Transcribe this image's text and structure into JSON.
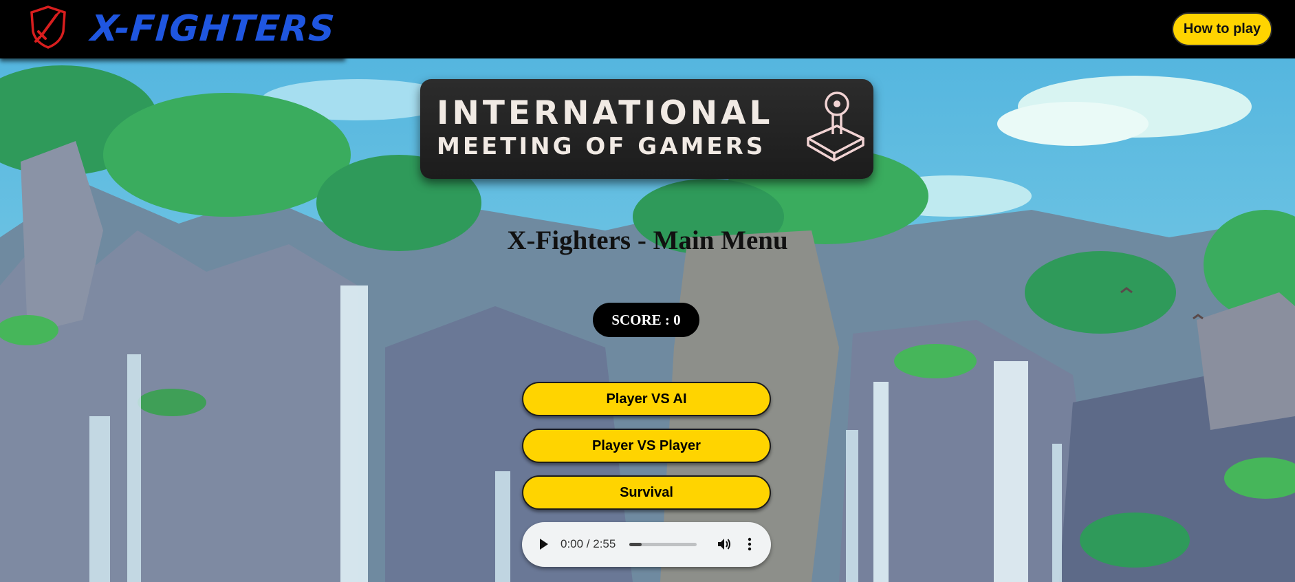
{
  "header": {
    "brand": "X-FIGHTERS",
    "brand_color": "#1f56e0",
    "logo_icon": "shield-sword-icon",
    "how_to_play_label": "How to play"
  },
  "banner": {
    "line1": "INTERNATIONAL",
    "line2": "MEETING OF GAMERS",
    "icon": "joystick-icon"
  },
  "menu": {
    "title": "X-Fighters - Main Menu",
    "score_label": "SCORE : 0",
    "buttons": {
      "player_vs_ai": "Player VS AI",
      "player_vs_player": "Player VS Player",
      "survival": "Survival"
    }
  },
  "audio": {
    "time": "0:00 / 2:55",
    "progress_fraction": 0.18
  },
  "colors": {
    "accent_yellow": "#ffd400",
    "logo_red": "#d81e1e",
    "header_bg": "#000000"
  }
}
